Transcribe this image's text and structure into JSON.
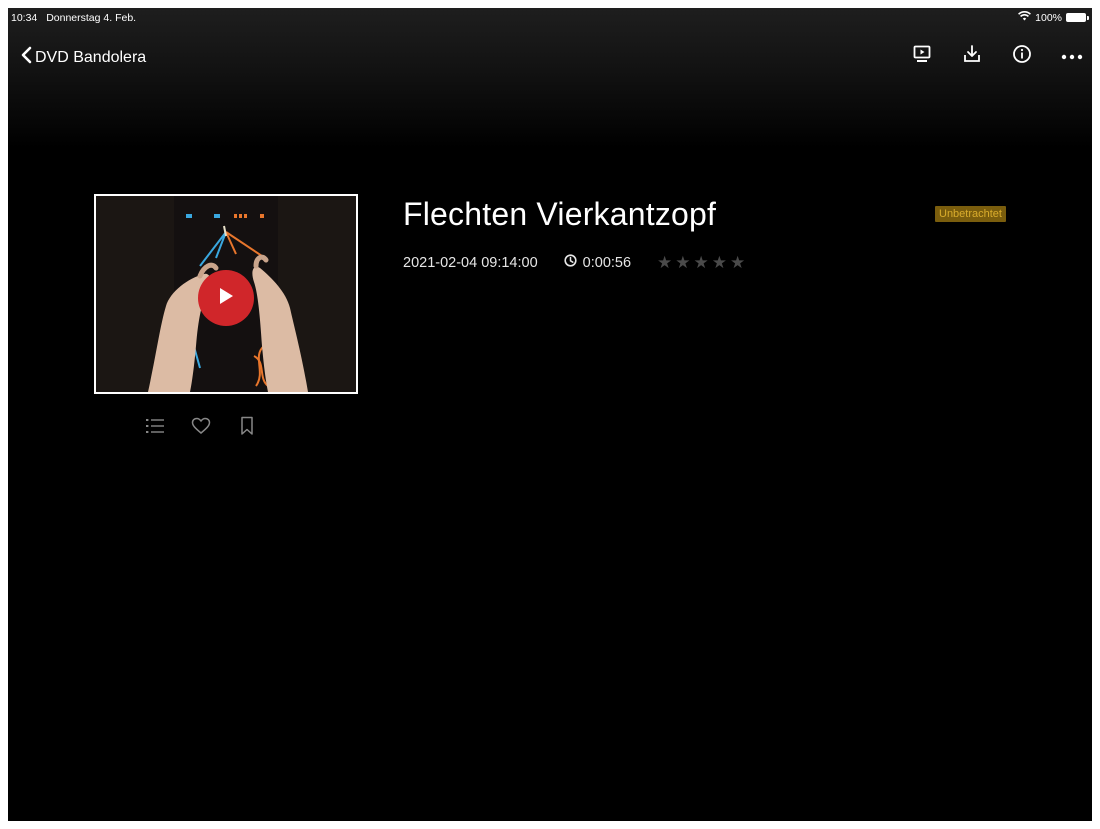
{
  "status_bar": {
    "time": "10:34",
    "date": "Donnerstag 4. Feb.",
    "battery": "100%"
  },
  "nav": {
    "back_label": "DVD Bandolera",
    "actions": [
      "slideshow-icon",
      "download-icon",
      "info-icon",
      "more-icon"
    ]
  },
  "video": {
    "title": "Flechten Vierkantzopf",
    "datetime": "2021-02-04 09:14:00",
    "duration": "0:00:56",
    "rating": 0,
    "max_rating": 5,
    "status_badge": "Unbetrachtet"
  },
  "thumbnail_actions": [
    "list-icon",
    "heart-icon",
    "bookmark-icon"
  ],
  "colors": {
    "background": "#000000",
    "play_button": "#d0262a",
    "badge_bg": "#7a5d0d",
    "badge_text": "#d9ac2c",
    "star_inactive": "#4a4a4a"
  }
}
